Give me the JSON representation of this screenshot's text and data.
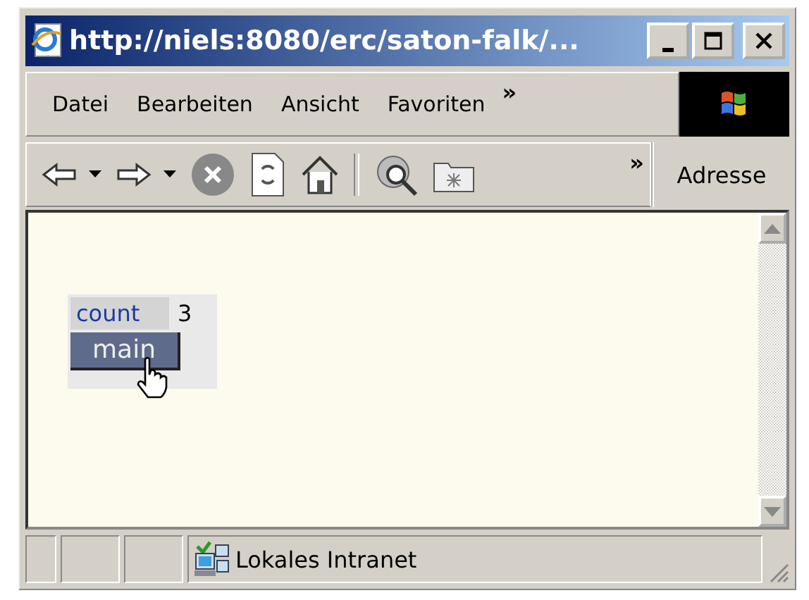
{
  "window": {
    "title": "http://niels:8080/erc/saton-falk/..."
  },
  "menu": {
    "items": [
      "Datei",
      "Bearbeiten",
      "Ansicht",
      "Favoriten"
    ],
    "overflow": "»"
  },
  "toolbar": {
    "overflow": "»",
    "address_label": "Adresse"
  },
  "page": {
    "label": "count",
    "value": "3",
    "button": "main"
  },
  "status_bar": {
    "zone": "Lokales Intranet"
  }
}
